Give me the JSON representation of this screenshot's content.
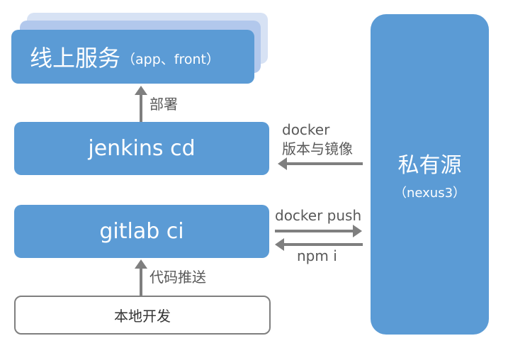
{
  "online_services": {
    "title": "线上服务",
    "subtitle": "（app、front）"
  },
  "jenkins": {
    "label": "jenkins cd"
  },
  "gitlab": {
    "label": "gitlab ci"
  },
  "local_dev": {
    "label": "本地开发"
  },
  "private_repo": {
    "title": "私有源",
    "subtitle": "（nexus3）"
  },
  "edges": {
    "deploy": "部署",
    "docker_version_line1": "docker",
    "docker_version_line2": "版本与镜像",
    "docker_push": "docker push",
    "npm_i": "npm i",
    "code_push": "代码推送"
  },
  "colors": {
    "box_fill": "#5b9bd5",
    "arrow": "#7f7f7f",
    "text": "#595959"
  }
}
